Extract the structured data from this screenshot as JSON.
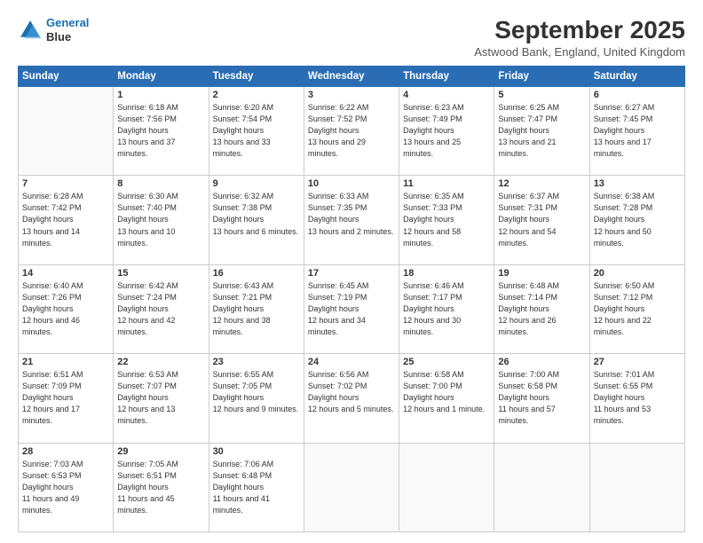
{
  "logo": {
    "line1": "General",
    "line2": "Blue"
  },
  "title": "September 2025",
  "subtitle": "Astwood Bank, England, United Kingdom",
  "weekdays": [
    "Sunday",
    "Monday",
    "Tuesday",
    "Wednesday",
    "Thursday",
    "Friday",
    "Saturday"
  ],
  "weeks": [
    [
      {
        "day": null,
        "sunrise": null,
        "sunset": null,
        "daylight": null
      },
      {
        "day": "1",
        "sunrise": "6:18 AM",
        "sunset": "7:56 PM",
        "daylight": "13 hours and 37 minutes."
      },
      {
        "day": "2",
        "sunrise": "6:20 AM",
        "sunset": "7:54 PM",
        "daylight": "13 hours and 33 minutes."
      },
      {
        "day": "3",
        "sunrise": "6:22 AM",
        "sunset": "7:52 PM",
        "daylight": "13 hours and 29 minutes."
      },
      {
        "day": "4",
        "sunrise": "6:23 AM",
        "sunset": "7:49 PM",
        "daylight": "13 hours and 25 minutes."
      },
      {
        "day": "5",
        "sunrise": "6:25 AM",
        "sunset": "7:47 PM",
        "daylight": "13 hours and 21 minutes."
      },
      {
        "day": "6",
        "sunrise": "6:27 AM",
        "sunset": "7:45 PM",
        "daylight": "13 hours and 17 minutes."
      }
    ],
    [
      {
        "day": "7",
        "sunrise": "6:28 AM",
        "sunset": "7:42 PM",
        "daylight": "13 hours and 14 minutes."
      },
      {
        "day": "8",
        "sunrise": "6:30 AM",
        "sunset": "7:40 PM",
        "daylight": "13 hours and 10 minutes."
      },
      {
        "day": "9",
        "sunrise": "6:32 AM",
        "sunset": "7:38 PM",
        "daylight": "13 hours and 6 minutes."
      },
      {
        "day": "10",
        "sunrise": "6:33 AM",
        "sunset": "7:35 PM",
        "daylight": "13 hours and 2 minutes."
      },
      {
        "day": "11",
        "sunrise": "6:35 AM",
        "sunset": "7:33 PM",
        "daylight": "12 hours and 58 minutes."
      },
      {
        "day": "12",
        "sunrise": "6:37 AM",
        "sunset": "7:31 PM",
        "daylight": "12 hours and 54 minutes."
      },
      {
        "day": "13",
        "sunrise": "6:38 AM",
        "sunset": "7:28 PM",
        "daylight": "12 hours and 50 minutes."
      }
    ],
    [
      {
        "day": "14",
        "sunrise": "6:40 AM",
        "sunset": "7:26 PM",
        "daylight": "12 hours and 46 minutes."
      },
      {
        "day": "15",
        "sunrise": "6:42 AM",
        "sunset": "7:24 PM",
        "daylight": "12 hours and 42 minutes."
      },
      {
        "day": "16",
        "sunrise": "6:43 AM",
        "sunset": "7:21 PM",
        "daylight": "12 hours and 38 minutes."
      },
      {
        "day": "17",
        "sunrise": "6:45 AM",
        "sunset": "7:19 PM",
        "daylight": "12 hours and 34 minutes."
      },
      {
        "day": "18",
        "sunrise": "6:46 AM",
        "sunset": "7:17 PM",
        "daylight": "12 hours and 30 minutes."
      },
      {
        "day": "19",
        "sunrise": "6:48 AM",
        "sunset": "7:14 PM",
        "daylight": "12 hours and 26 minutes."
      },
      {
        "day": "20",
        "sunrise": "6:50 AM",
        "sunset": "7:12 PM",
        "daylight": "12 hours and 22 minutes."
      }
    ],
    [
      {
        "day": "21",
        "sunrise": "6:51 AM",
        "sunset": "7:09 PM",
        "daylight": "12 hours and 17 minutes."
      },
      {
        "day": "22",
        "sunrise": "6:53 AM",
        "sunset": "7:07 PM",
        "daylight": "12 hours and 13 minutes."
      },
      {
        "day": "23",
        "sunrise": "6:55 AM",
        "sunset": "7:05 PM",
        "daylight": "12 hours and 9 minutes."
      },
      {
        "day": "24",
        "sunrise": "6:56 AM",
        "sunset": "7:02 PM",
        "daylight": "12 hours and 5 minutes."
      },
      {
        "day": "25",
        "sunrise": "6:58 AM",
        "sunset": "7:00 PM",
        "daylight": "12 hours and 1 minute."
      },
      {
        "day": "26",
        "sunrise": "7:00 AM",
        "sunset": "6:58 PM",
        "daylight": "11 hours and 57 minutes."
      },
      {
        "day": "27",
        "sunrise": "7:01 AM",
        "sunset": "6:55 PM",
        "daylight": "11 hours and 53 minutes."
      }
    ],
    [
      {
        "day": "28",
        "sunrise": "7:03 AM",
        "sunset": "6:53 PM",
        "daylight": "11 hours and 49 minutes."
      },
      {
        "day": "29",
        "sunrise": "7:05 AM",
        "sunset": "6:51 PM",
        "daylight": "11 hours and 45 minutes."
      },
      {
        "day": "30",
        "sunrise": "7:06 AM",
        "sunset": "6:48 PM",
        "daylight": "11 hours and 41 minutes."
      },
      {
        "day": null,
        "sunrise": null,
        "sunset": null,
        "daylight": null
      },
      {
        "day": null,
        "sunrise": null,
        "sunset": null,
        "daylight": null
      },
      {
        "day": null,
        "sunrise": null,
        "sunset": null,
        "daylight": null
      },
      {
        "day": null,
        "sunrise": null,
        "sunset": null,
        "daylight": null
      }
    ]
  ]
}
